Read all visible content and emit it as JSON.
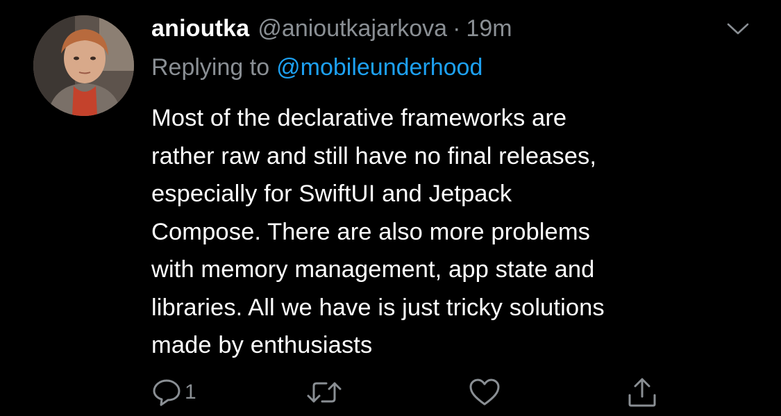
{
  "tweet": {
    "display_name": "anioutka",
    "handle": "@anioutkajarkova",
    "separator": "·",
    "time": "19m",
    "reply_prefix": "Replying to",
    "reply_mention": "@mobileunderhood",
    "body_lines": [
      "Most of the declarative frameworks are",
      "rather raw and still have no final releases,",
      "especially for SwiftUI and Jetpack",
      "Compose. There are also more problems",
      "with memory management, app state and",
      "libraries. All we have is just tricky solutions",
      "made by enthusiasts"
    ],
    "actions": {
      "reply_count": "1",
      "reply_icon": "reply-icon",
      "retweet_icon": "retweet-icon",
      "like_icon": "heart-icon",
      "share_icon": "share-icon"
    },
    "menu_icon": "chevron-down-icon"
  },
  "colors": {
    "background": "#000000",
    "primary_text": "#ffffff",
    "secondary_text": "#8a8f94",
    "link": "#1da1f2"
  }
}
